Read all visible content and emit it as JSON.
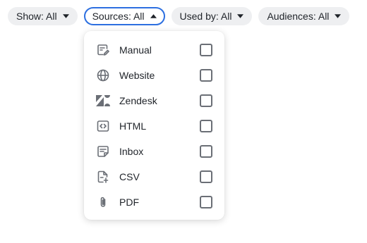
{
  "filters": [
    {
      "label": "Show: All"
    },
    {
      "label": "Sources: All"
    },
    {
      "label": "Used by: All"
    },
    {
      "label": "Audiences: All"
    }
  ],
  "sources_dropdown": {
    "options": [
      {
        "label": "Manual",
        "icon": "manual-edit-icon",
        "checked": false
      },
      {
        "label": "Website",
        "icon": "globe-icon",
        "checked": false
      },
      {
        "label": "Zendesk",
        "icon": "zendesk-icon",
        "checked": false
      },
      {
        "label": "HTML",
        "icon": "code-icon",
        "checked": false
      },
      {
        "label": "Inbox",
        "icon": "note-icon",
        "checked": false
      },
      {
        "label": "CSV",
        "icon": "file-import-icon",
        "checked": false
      },
      {
        "label": "PDF",
        "icon": "paperclip-icon",
        "checked": false
      }
    ]
  },
  "colors": {
    "active_border": "#2c6fe0",
    "chip_background": "#eeeff1",
    "icon_gray": "#6b6f76"
  }
}
